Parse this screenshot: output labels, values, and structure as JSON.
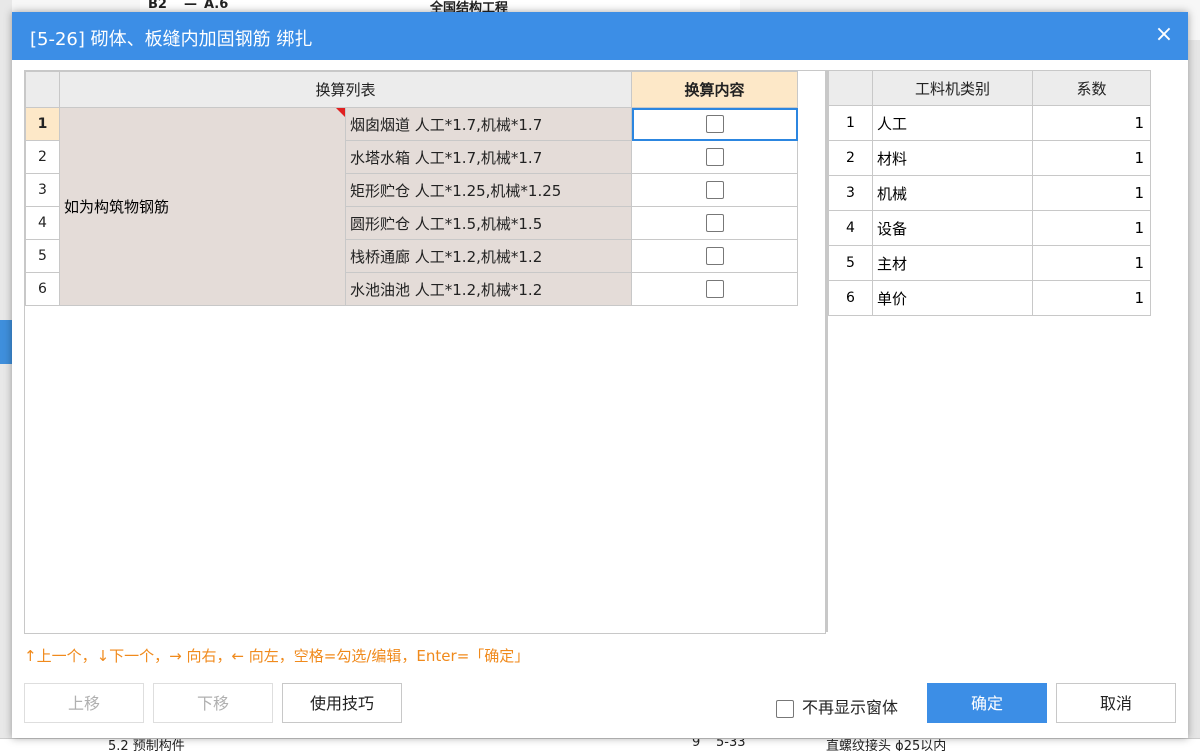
{
  "background": {
    "top_cells": [
      "B2",
      "—",
      "A.6",
      "全国结构工程"
    ],
    "bottom_cells": [
      "5.2 预制构件",
      "9",
      "5-33",
      "直螺纹接头 ϕ25以内"
    ]
  },
  "dialog": {
    "title": "[5-26] 砌体、板缝内加固钢筋 绑扎",
    "close_icon": "×"
  },
  "left_table": {
    "headers": {
      "list": "换算列表",
      "content": "换算内容"
    },
    "category": "如为构筑物钢筋",
    "rows": [
      {
        "num": "1",
        "item": "烟囱烟道 人工*1.7,机械*1.7",
        "checked": false
      },
      {
        "num": "2",
        "item": "水塔水箱 人工*1.7,机械*1.7",
        "checked": false
      },
      {
        "num": "3",
        "item": "矩形贮仓 人工*1.25,机械*1.25",
        "checked": false
      },
      {
        "num": "4",
        "item": "圆形贮仓 人工*1.5,机械*1.5",
        "checked": false
      },
      {
        "num": "5",
        "item": "栈桥通廊 人工*1.2,机械*1.2",
        "checked": false
      },
      {
        "num": "6",
        "item": "水池油池 人工*1.2,机械*1.2",
        "checked": false
      }
    ]
  },
  "right_table": {
    "headers": {
      "category": "工料机类别",
      "coef": "系数"
    },
    "rows": [
      {
        "num": "1",
        "name": "人工",
        "value": "1"
      },
      {
        "num": "2",
        "name": "材料",
        "value": "1"
      },
      {
        "num": "3",
        "name": "机械",
        "value": "1"
      },
      {
        "num": "4",
        "name": "设备",
        "value": "1"
      },
      {
        "num": "5",
        "name": "主材",
        "value": "1"
      },
      {
        "num": "6",
        "name": "单价",
        "value": "1"
      }
    ]
  },
  "hint": "↑上一个，↓下一个，→ 向右，← 向左，空格=勾选/编辑，Enter=「确定」",
  "buttons": {
    "move_up": "上移",
    "move_down": "下移",
    "tips": "使用技巧",
    "ok": "确定",
    "cancel": "取消"
  },
  "no_show_label": "不再显示窗体",
  "colors": {
    "title_bar": "#3c8ee6",
    "hint": "#f08a1c",
    "header_highlight": "#fde8c8",
    "cell_fill": "#e4dcd8"
  }
}
